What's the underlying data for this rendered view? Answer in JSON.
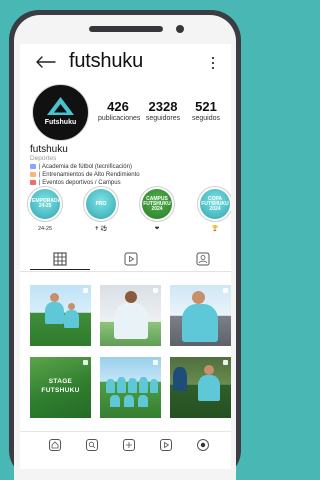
{
  "profile": {
    "username": "futshuku",
    "stats": [
      {
        "value": "426",
        "label": "publicaciones"
      },
      {
        "value": "2328",
        "label": "seguidores"
      },
      {
        "value": "521",
        "label": "seguidos"
      }
    ],
    "bio": {
      "name": "futshuku",
      "category": "Deportes",
      "lines": [
        "| Academia de fútbol (tecnificación)",
        "| Entrenamientos de Alto Rendimiento",
        "| Eventos deportivos / Campus"
      ]
    },
    "avatar_text": "Futshuku"
  },
  "highlights": [
    {
      "cover_text": "TEMPORADA 24-25",
      "label": "24-25"
    },
    {
      "cover_text": "PRO",
      "label": "✝ ⚽"
    },
    {
      "cover_text": "CAMPUS FUTSHUKU 2024",
      "label": "❤"
    },
    {
      "cover_text": "COPA FUTSHUKU 2024",
      "label": "🏆"
    }
  ],
  "posts": [
    {
      "kind": "photo"
    },
    {
      "kind": "photo"
    },
    {
      "kind": "photo"
    },
    {
      "kind": "graphic",
      "text": "STAGE FUTSHUKU"
    },
    {
      "kind": "photo"
    },
    {
      "kind": "photo"
    }
  ],
  "colors": {
    "background": "#49b8b4",
    "phone_frame": "#3b3d42",
    "accent": "#5fc8d8"
  },
  "icons": {
    "back": "arrow-left-icon",
    "more": "more-vertical-icon",
    "tabs": [
      "grid-icon",
      "reels-icon",
      "tagged-icon"
    ],
    "nav": [
      "home-icon",
      "search-icon",
      "add-icon",
      "reels-icon",
      "profile-icon"
    ]
  }
}
